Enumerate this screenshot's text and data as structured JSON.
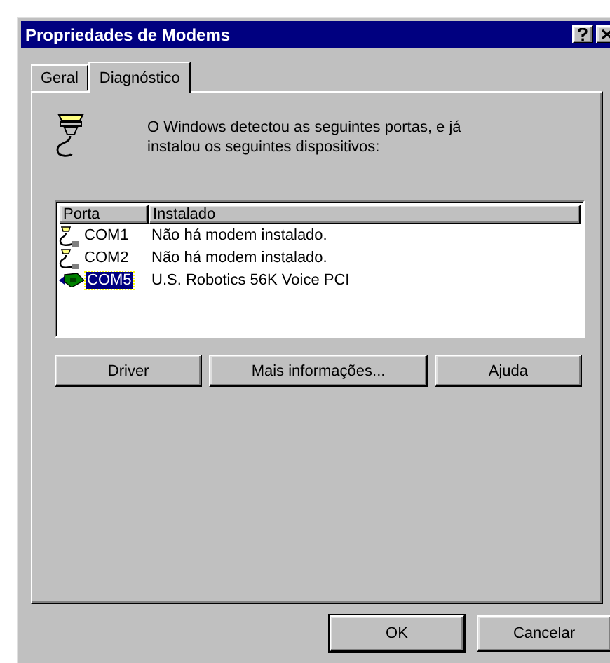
{
  "window": {
    "title": "Propriedades de Modems"
  },
  "tabs": [
    {
      "label": "Geral",
      "selected": false
    },
    {
      "label": "Diagnóstico",
      "selected": true
    }
  ],
  "intro": "O Windows detectou as seguintes portas, e já instalou os seguintes dispositivos:",
  "table": {
    "columns": [
      "Porta",
      "Instalado"
    ],
    "rows": [
      {
        "kind": "port",
        "port": "COM1",
        "installed": "Não há modem instalado.",
        "selected": false
      },
      {
        "kind": "port",
        "port": "COM2",
        "installed": "Não há modem instalado.",
        "selected": false
      },
      {
        "kind": "modem",
        "port": "COM5",
        "installed": "U.S. Robotics 56K Voice PCI",
        "selected": true
      }
    ]
  },
  "actions": [
    "Driver",
    "Mais informações...",
    "Ajuda"
  ],
  "buttons": [
    {
      "label": "OK",
      "default": true
    },
    {
      "label": "Cancelar",
      "default": false
    }
  ]
}
